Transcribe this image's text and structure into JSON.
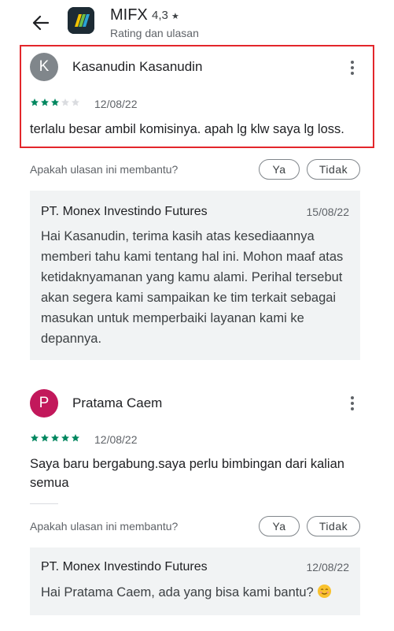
{
  "header": {
    "app_name": "MIFX",
    "rating": "4,3",
    "subtitle": "Rating dan ulasan"
  },
  "reviews": [
    {
      "initial": "K",
      "avatar_color": "#80868b",
      "name": "Kasanudin Kasanudin",
      "stars": 3,
      "date": "12/08/22",
      "text": "terlalu besar ambil komisinya. apah lg klw saya lg loss.",
      "helpful_question": "Apakah ulasan ini membantu?",
      "yes_label": "Ya",
      "no_label": "Tidak",
      "reply": {
        "developer": "PT. Monex Investindo Futures",
        "date": "15/08/22",
        "text": "Hai Kasanudin, terima kasih atas kesediaannya memberi tahu kami tentang hal ini. Mohon maaf atas ketidaknyamanan yang kamu alami. Perihal tersebut akan segera kami sampaikan ke tim terkait sebagai masukan untuk memperbaiki layanan kami ke depannya."
      }
    },
    {
      "initial": "P",
      "avatar_color": "#c2185b",
      "name": "Pratama Caem",
      "stars": 5,
      "date": "12/08/22",
      "text": "Saya baru bergabung.saya perlu bimbingan dari kalian semua",
      "helpful_question": "Apakah ulasan ini membantu?",
      "yes_label": "Ya",
      "no_label": "Tidak",
      "reply": {
        "developer": "PT. Monex Investindo Futures",
        "date": "12/08/22",
        "text": "Hai Pratama Caem, ada yang bisa kami bantu?",
        "emoji": "smiling-face-icon"
      }
    }
  ],
  "colors": {
    "star_filled": "#01875f",
    "star_empty": "#dadce0",
    "highlight_border": "#e3262b"
  }
}
